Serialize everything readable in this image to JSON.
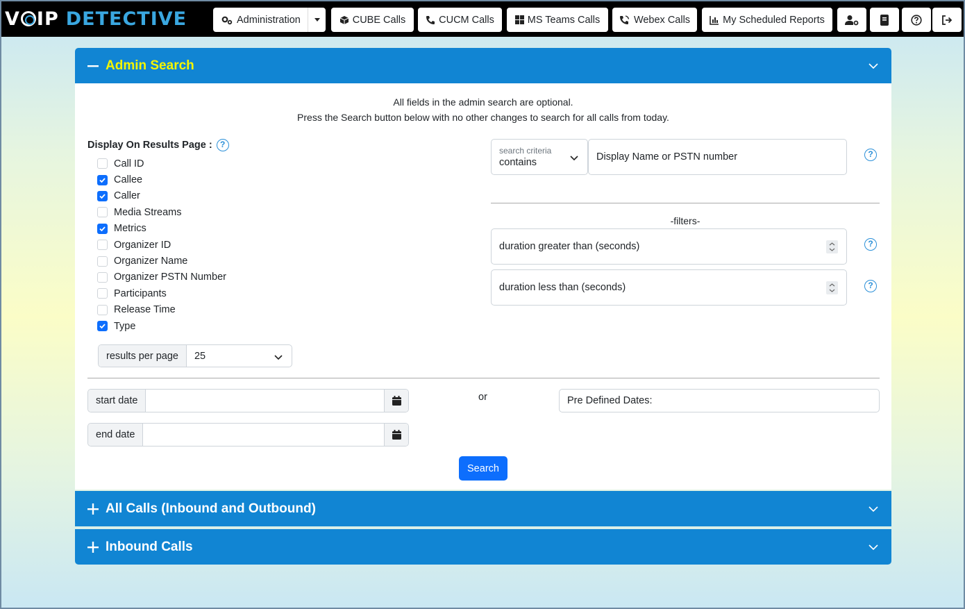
{
  "app": {
    "logo_part1": "V",
    "logo_part2": "IP",
    "logo_part3": "DETECTIVE"
  },
  "nav": {
    "administration": "Administration",
    "cube": "CUBE Calls",
    "cucm": "CUCM Calls",
    "msteams": "MS Teams Calls",
    "webex": "Webex Calls",
    "reports": "My Scheduled Reports"
  },
  "admin": {
    "title": "Admin Search",
    "intro_line1": "All fields in the admin search are optional.",
    "intro_line2": "Press the Search button below with no other changes to search for all calls from today.",
    "display_label": "Display On Results Page :",
    "columns": [
      {
        "label": "Call ID",
        "checked": false
      },
      {
        "label": "Callee",
        "checked": true
      },
      {
        "label": "Caller",
        "checked": true
      },
      {
        "label": "Media Streams",
        "checked": false
      },
      {
        "label": "Metrics",
        "checked": true
      },
      {
        "label": "Organizer ID",
        "checked": false
      },
      {
        "label": "Organizer Name",
        "checked": false
      },
      {
        "label": "Organizer PSTN Number",
        "checked": false
      },
      {
        "label": "Participants",
        "checked": false
      },
      {
        "label": "Release Time",
        "checked": false
      },
      {
        "label": "Type",
        "checked": true
      }
    ],
    "results_per_page_label": "results per page",
    "results_per_page_value": "25",
    "criteria_label": "search criteria",
    "criteria_value": "contains",
    "search_placeholder": "Display Name or PSTN number",
    "filters_label": "-filters-",
    "duration_gt_placeholder": "duration greater than (seconds)",
    "duration_lt_placeholder": "duration less than (seconds)",
    "start_date_label": "start date",
    "end_date_label": "end date",
    "or_label": "or",
    "predefined_dates": "Pre Defined Dates:",
    "search_button": "Search",
    "help_glyph": "?"
  },
  "panels": {
    "all_calls": "All Calls (Inbound and Outbound)",
    "inbound": "Inbound Calls"
  },
  "colors": {
    "panel_blue": "#1185d3",
    "title_yellow": "#f5f500",
    "primary": "#0d6efd"
  }
}
